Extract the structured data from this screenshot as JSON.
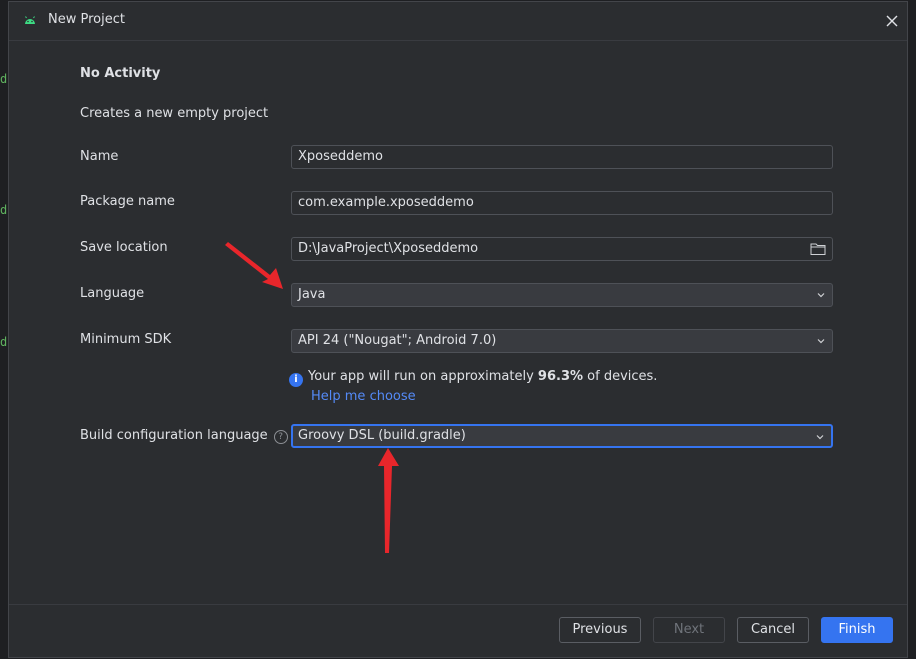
{
  "dialog": {
    "title": "New Project"
  },
  "template": {
    "heading": "No Activity",
    "description": "Creates a new empty project"
  },
  "form": {
    "name": {
      "label": "Name",
      "value": "Xposeddemo"
    },
    "package_name": {
      "label": "Package name",
      "value": "com.example.xposeddemo"
    },
    "save_location": {
      "label": "Save location",
      "value": "D:\\JavaProject\\Xposeddemo"
    },
    "language": {
      "label": "Language",
      "value": "Java"
    },
    "minimum_sdk": {
      "label": "Minimum SDK",
      "value": "API 24 (\"Nougat\"; Android 7.0)"
    },
    "info": {
      "prefix": "Your app will run on approximately ",
      "percent": "96.3%",
      "suffix": " of devices.",
      "help_link": "Help me choose"
    },
    "build_config": {
      "label": "Build configuration language",
      "value": "Groovy DSL (build.gradle)"
    }
  },
  "footer": {
    "previous": "Previous",
    "next": "Next",
    "cancel": "Cancel",
    "finish": "Finish"
  },
  "icons": {
    "app": "android-icon",
    "close": "close-icon",
    "folder": "folder-icon",
    "chevron": "chevron-down-icon",
    "info": "info-icon",
    "help": "question-mark-icon"
  },
  "colors": {
    "accent": "#3574f0",
    "link": "#548af7",
    "annotation_arrow": "#e8262b"
  }
}
